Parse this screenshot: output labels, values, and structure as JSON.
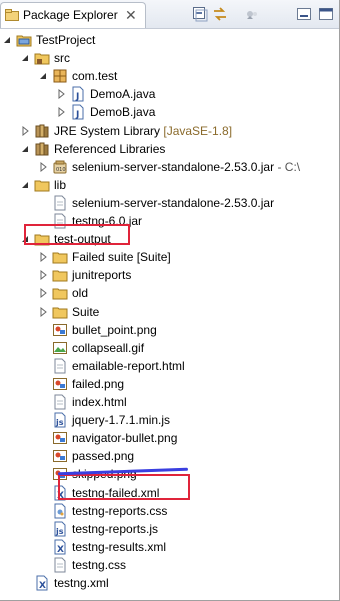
{
  "view": {
    "title": "Package Explorer",
    "close_glyph": "✕"
  },
  "toolbar": [
    "collapse-all-icon",
    "link-with-editor-icon",
    "view-menu-icon",
    "minimize-icon",
    "maximize-icon"
  ],
  "tree": [
    {
      "label": "TestProject",
      "depth": 0,
      "icon": "project-icon",
      "expanded": true
    },
    {
      "label": "src",
      "depth": 1,
      "icon": "source-folder-icon",
      "expanded": true
    },
    {
      "label": "com.test",
      "depth": 2,
      "icon": "package-icon",
      "expanded": true
    },
    {
      "label": "DemoA.java",
      "depth": 3,
      "icon": "java-file-icon",
      "expanded": false
    },
    {
      "label": "DemoB.java",
      "depth": 3,
      "icon": "java-file-icon",
      "expanded": false
    },
    {
      "label": "JRE System Library",
      "suffix": "[JavaSE-1.8]",
      "depth": 1,
      "icon": "library-icon",
      "expanded": false
    },
    {
      "label": "Referenced Libraries",
      "depth": 1,
      "icon": "library-icon",
      "expanded": true
    },
    {
      "label": "selenium-server-standalone-2.53.0.jar",
      "suffix": " - C:\\",
      "depth": 2,
      "icon": "jar-icon",
      "expanded": false
    },
    {
      "label": "lib",
      "depth": 1,
      "icon": "folder-icon",
      "expanded": true
    },
    {
      "label": "selenium-server-standalone-2.53.0.jar",
      "depth": 2,
      "icon": "file-icon",
      "expanded": null
    },
    {
      "label": "testng-6.0.jar",
      "depth": 2,
      "icon": "file-icon",
      "expanded": null
    },
    {
      "label": "test-output",
      "depth": 1,
      "icon": "folder-icon",
      "expanded": true
    },
    {
      "label": "Failed suite [Suite]",
      "depth": 2,
      "icon": "folder-icon",
      "expanded": false
    },
    {
      "label": "junitreports",
      "depth": 2,
      "icon": "folder-icon",
      "expanded": false
    },
    {
      "label": "old",
      "depth": 2,
      "icon": "folder-icon",
      "expanded": false
    },
    {
      "label": "Suite",
      "depth": 2,
      "icon": "folder-icon",
      "expanded": false
    },
    {
      "label": "bullet_point.png",
      "depth": 2,
      "icon": "image-icon",
      "expanded": null
    },
    {
      "label": "collapseall.gif",
      "depth": 2,
      "icon": "gif-icon",
      "expanded": null
    },
    {
      "label": "emailable-report.html",
      "depth": 2,
      "icon": "file-icon",
      "expanded": null
    },
    {
      "label": "failed.png",
      "depth": 2,
      "icon": "image-icon",
      "expanded": null
    },
    {
      "label": "index.html",
      "depth": 2,
      "icon": "file-icon",
      "expanded": null
    },
    {
      "label": "jquery-1.7.1.min.js",
      "depth": 2,
      "icon": "js-file-icon",
      "expanded": null
    },
    {
      "label": "navigator-bullet.png",
      "depth": 2,
      "icon": "image-icon",
      "expanded": null
    },
    {
      "label": "passed.png",
      "depth": 2,
      "icon": "image-icon",
      "expanded": null
    },
    {
      "label": "skipped.png",
      "depth": 2,
      "icon": "image-icon",
      "expanded": null
    },
    {
      "label": "testng-failed.xml",
      "depth": 2,
      "icon": "xml-file-icon",
      "expanded": null
    },
    {
      "label": "testng-reports.css",
      "depth": 2,
      "icon": "css-file-icon",
      "expanded": null
    },
    {
      "label": "testng-reports.js",
      "depth": 2,
      "icon": "js-file-icon",
      "expanded": null
    },
    {
      "label": "testng-results.xml",
      "depth": 2,
      "icon": "xml-file-icon",
      "expanded": null
    },
    {
      "label": "testng.css",
      "depth": 2,
      "icon": "file-icon",
      "expanded": null
    },
    {
      "label": "testng.xml",
      "depth": 1,
      "icon": "xml-file-icon",
      "expanded": null
    }
  ],
  "highlights": {
    "color": "#e0243a",
    "underline_color": "#3a3fe0"
  }
}
